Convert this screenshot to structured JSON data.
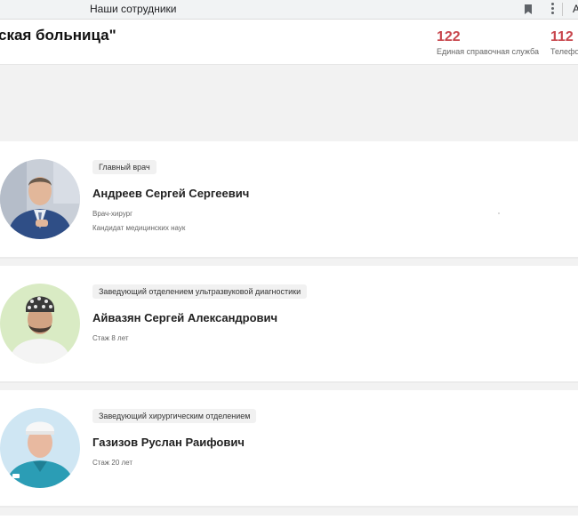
{
  "browser": {
    "tab_title": "Наши сотрудники",
    "edge_char": "А"
  },
  "header": {
    "site_title": "ская больница\"",
    "contacts": [
      {
        "number": "122",
        "label": "Единая справочная служба"
      },
      {
        "number": "112",
        "label": "Телефон"
      }
    ]
  },
  "staff": [
    {
      "position": "Главный врач",
      "name": "Андреев Сергей Сергеевич",
      "lines": [
        "Врач-хирург",
        "Кандидат медицинских наук"
      ]
    },
    {
      "position": "Заведующий отделением ультразвуковой диагностики",
      "name": "Айвазян Сергей Александрович",
      "lines": [
        "Стаж 8 лет"
      ]
    },
    {
      "position": "Заведующий хирургическим отделением",
      "name": "Газизов Руслан Раифович",
      "lines": [
        "Стаж 20 лет"
      ]
    }
  ],
  "colors": {
    "accent": "#c8464d",
    "page_bg": "#f2f2f2",
    "card_bg": "#ffffff"
  }
}
